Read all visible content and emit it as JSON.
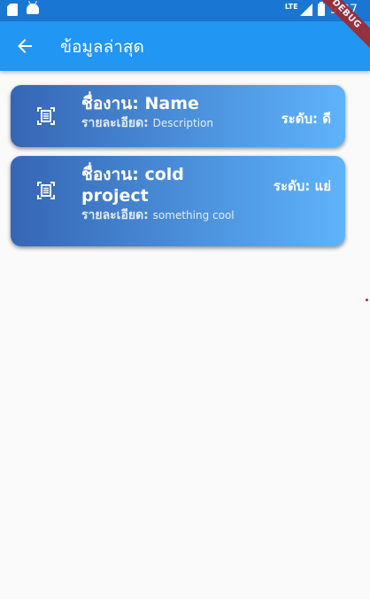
{
  "status_bar": {
    "time": "9:27",
    "network_label": "LTE",
    "icons": [
      "sd-card-icon",
      "android-icon",
      "signal-icon",
      "battery-icon"
    ]
  },
  "app_bar": {
    "title": "ข้อมูลล่าสุด",
    "back_icon": "arrow-back-icon",
    "color": "#2196f3"
  },
  "debug_banner": "DEBUG",
  "cards": [
    {
      "icon": "document-scan-icon",
      "title_prefix": "ชื่องาน: ",
      "title": "Name",
      "desc_label": "รายละเอียด: ",
      "description": "Description",
      "level_label": "ระดับ: ",
      "level": "ดี"
    },
    {
      "icon": "document-scan-icon",
      "title_prefix": "ชื่องาน: ",
      "title": "cold project",
      "desc_label": "รายละเอียด: ",
      "description": "something cool",
      "level_label": "ระดับ: ",
      "level": "แย่"
    }
  ],
  "colors": {
    "card_gradient_start": "#3566b5",
    "card_gradient_end": "#5eb3fb",
    "status_bar": "#1976d2"
  }
}
